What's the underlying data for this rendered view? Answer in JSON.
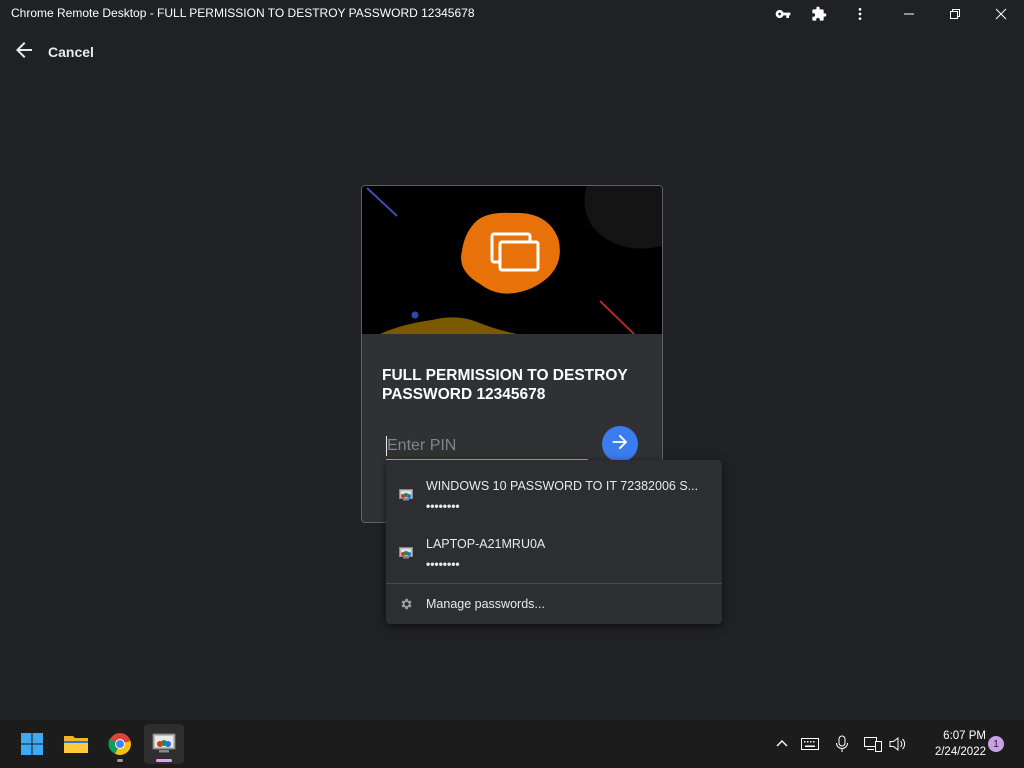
{
  "window": {
    "title": "Chrome Remote Desktop - FULL PERMISSION TO DESTROY PASSWORD 12345678",
    "icons": [
      "key-icon",
      "puzzle-icon",
      "more-vert-icon"
    ],
    "controls": [
      "minimize-icon",
      "restore-icon",
      "close-icon"
    ]
  },
  "topbar": {
    "cancel_label": "Cancel",
    "icon": "arrow-back-icon"
  },
  "card": {
    "host_name": "FULL PERMISSION TO DESTROY PASSWORD 12345678",
    "pin_placeholder": "Enter PIN",
    "submit_icon": "arrow-forward-icon",
    "accent": "#3b7cf0",
    "hero_blob": "#e8710a"
  },
  "autofill": {
    "items": [
      {
        "name": "WINDOWS 10 PASSWORD TO IT 72382006 S...",
        "password": "••••••••"
      },
      {
        "name": "LAPTOP-A21MRU0A",
        "password": "••••••••"
      }
    ],
    "manage_label": "Manage passwords..."
  },
  "taskbar": {
    "apps": [
      "windows-start-icon",
      "file-explorer-icon",
      "chrome-icon",
      "remote-desktop-icon"
    ],
    "tray": [
      "chevron-up-icon",
      "keyboard-icon",
      "microphone-icon",
      "network-icon",
      "speaker-icon"
    ],
    "time": "6:07 PM",
    "date": "2/24/2022",
    "notification_count": "1"
  }
}
